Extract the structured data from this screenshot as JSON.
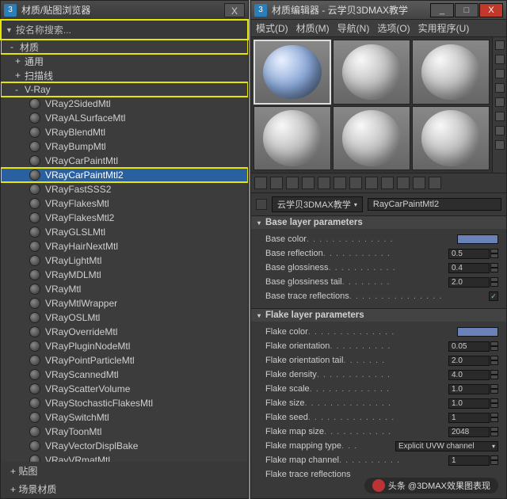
{
  "left": {
    "title": "材质/贴图浏览器",
    "search": "按名称搜索...",
    "root": "材质",
    "groups": {
      "general": "通用",
      "scanline": "扫描线",
      "vray": "V-Ray"
    },
    "items": [
      "VRay2SidedMtl",
      "VRayALSurfaceMtl",
      "VRayBlendMtl",
      "VRayBumpMtl",
      "VRayCarPaintMtl",
      "VRayCarPaintMtl2",
      "VRayFastSSS2",
      "VRayFlakesMtl",
      "VRayFlakesMtl2",
      "VRayGLSLMtl",
      "VRayHairNextMtl",
      "VRayLightMtl",
      "VRayMDLMtl",
      "VRayMtl",
      "VRayMtlWrapper",
      "VRayOSLMtl",
      "VRayOverrideMtl",
      "VRayPluginNodeMtl",
      "VRayPointParticleMtl",
      "VRayScannedMtl",
      "VRayScatterVolume",
      "VRayStochasticFlakesMtl",
      "VRaySwitchMtl",
      "VRayToonMtl",
      "VRayVectorDisplBake",
      "VRayVRmatMtl"
    ],
    "footer1": "贴图",
    "footer2": "场景材质"
  },
  "right": {
    "title": "材质编辑器 - 云学贝3DMAX教学",
    "menus": {
      "mode": "模式(D)",
      "material": "材质(M)",
      "nav": "导航(N)",
      "options": "选项(O)",
      "util": "实用程序(U)"
    },
    "current_name": "云学贝3DMAX教学",
    "current_type": "RayCarPaintMtl2",
    "rollouts": {
      "base": {
        "title": "Base layer parameters",
        "base_color": "Base color",
        "base_reflection": "Base reflection",
        "base_glossiness": "Base glossiness",
        "base_gloss_tail": "Base glossiness tail",
        "base_trace": "Base trace reflections",
        "vals": {
          "reflection": "0.5",
          "glossiness": "0.4",
          "gloss_tail": "2.0"
        },
        "color_hex": "#6a82b8"
      },
      "flake": {
        "title": "Flake layer parameters",
        "flake_color": "Flake color",
        "flake_orient": "Flake orientation",
        "flake_orient_tail": "Flake orientation tail",
        "flake_density": "Flake density",
        "flake_scale": "Flake scale",
        "flake_size": "Flake size",
        "flake_seed": "Flake seed",
        "flake_map_size": "Flake map size",
        "flake_map_type": "Flake mapping type",
        "flake_map_channel": "Flake map channel",
        "flake_trace": "Flake trace reflections",
        "vals": {
          "orient": "0.05",
          "orient_tail": "2.0",
          "density": "4.0",
          "scale": "1.0",
          "size": "1.0",
          "seed": "1",
          "map_size": "2048",
          "map_type": "Explicit UVW channel",
          "map_channel": "1"
        },
        "color_hex": "#6a82b8"
      }
    },
    "watermark": "头条 @3DMAX效果图表现"
  }
}
